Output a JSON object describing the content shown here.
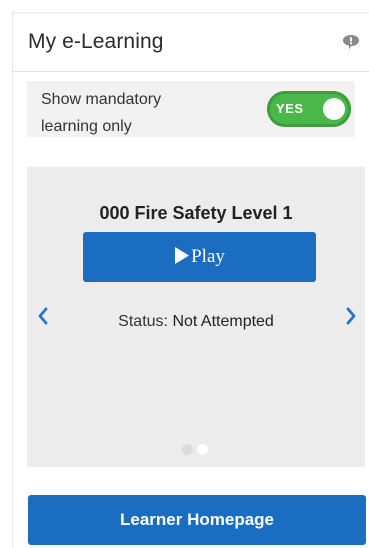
{
  "widget": {
    "title": "My e-Learning",
    "help_icon": "speech-bubble-icon"
  },
  "filter": {
    "label": "Show mandatory learning only",
    "toggle_text": "YES",
    "toggle_on": true,
    "toggle_color": "#49b749"
  },
  "carousel": {
    "course_title": "000 Fire Safety Level 1",
    "play_label": "Play",
    "status_label": "Status:",
    "status_value": "Not Attempted",
    "page_count": 2,
    "active_page": 2,
    "prev_icon": "chevron-left-icon",
    "next_icon": "chevron-right-icon"
  },
  "footer": {
    "home_button_label": "Learner Homepage"
  },
  "colors": {
    "primary_button": "#1b6dc1",
    "card_background": "#ececec",
    "arrow": "#2a72c8"
  }
}
